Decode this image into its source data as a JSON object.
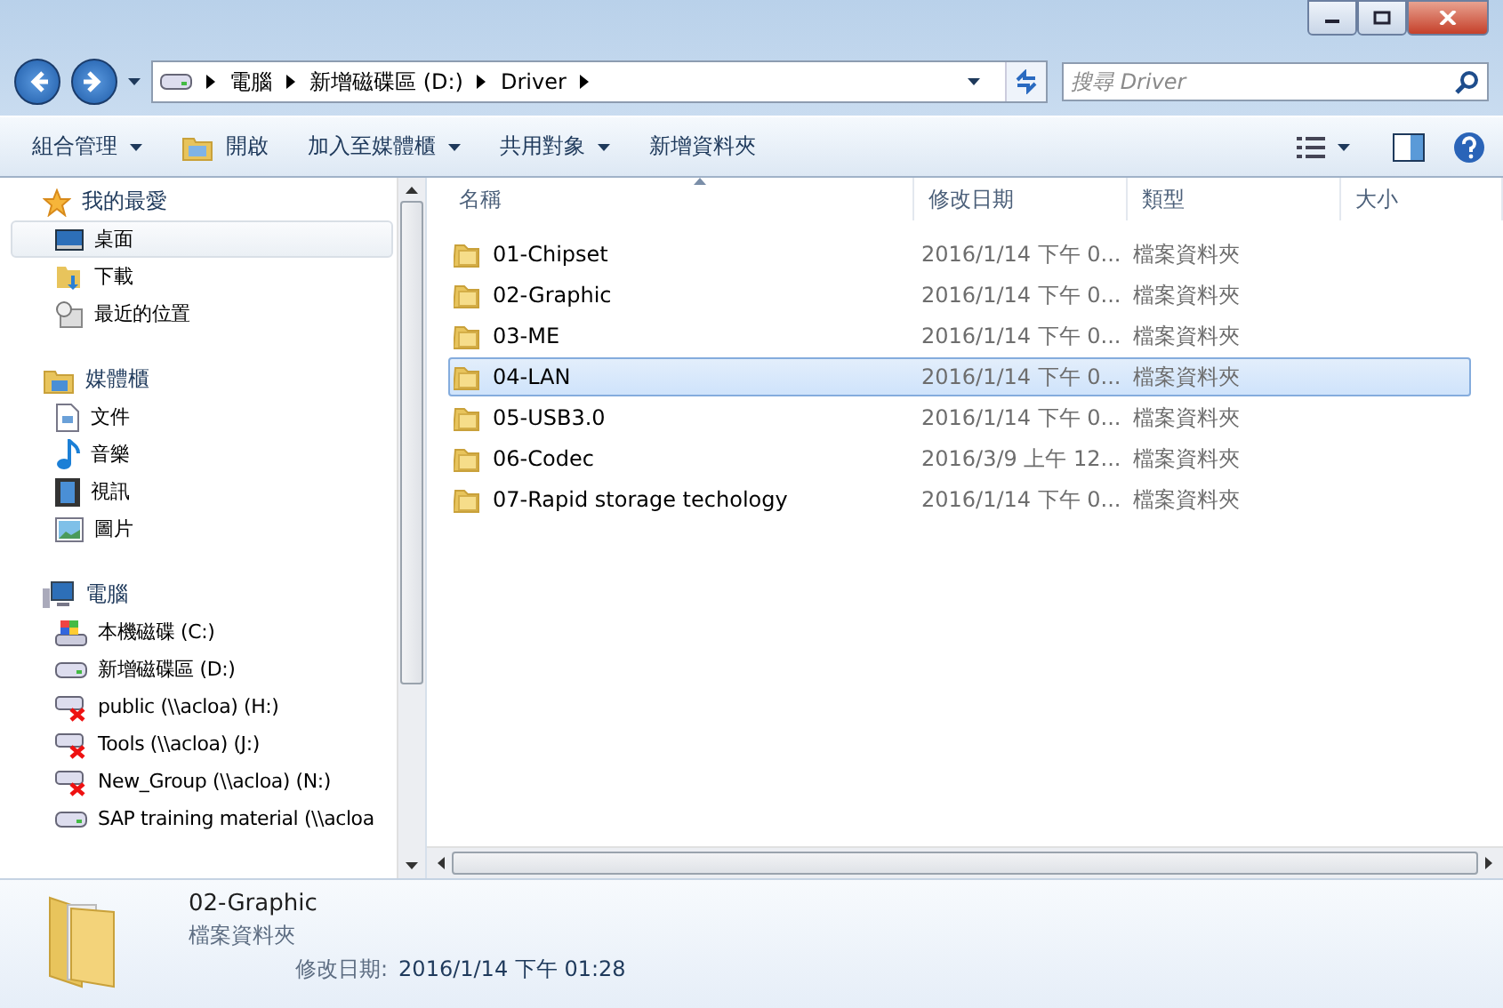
{
  "address": {
    "crumbs": [
      "電腦",
      "新增磁碟區 (D:)",
      "Driver"
    ],
    "search_placeholder": "搜尋 Driver"
  },
  "toolbar": {
    "items": [
      {
        "label": "組合管理",
        "menu": true,
        "kind": "text"
      },
      {
        "label": "開啟",
        "menu": false,
        "kind": "open"
      },
      {
        "label": "加入至媒體櫃",
        "menu": true,
        "kind": "text"
      },
      {
        "label": "共用對象",
        "menu": true,
        "kind": "text"
      },
      {
        "label": "新增資料夾",
        "menu": false,
        "kind": "text"
      }
    ]
  },
  "nav": {
    "groups": [
      {
        "label": "我的最愛",
        "kind": "star",
        "children": [
          {
            "label": "桌面",
            "kind": "desktop",
            "selected": true
          },
          {
            "label": "下載",
            "kind": "download",
            "selected": false
          },
          {
            "label": "最近的位置",
            "kind": "recent",
            "selected": false
          }
        ]
      },
      {
        "label": "媒體櫃",
        "kind": "library",
        "children": [
          {
            "label": "文件",
            "kind": "document",
            "selected": false
          },
          {
            "label": "音樂",
            "kind": "music",
            "selected": false
          },
          {
            "label": "視訊",
            "kind": "video",
            "selected": false
          },
          {
            "label": "圖片",
            "kind": "picture",
            "selected": false
          }
        ]
      },
      {
        "label": "電腦",
        "kind": "computer",
        "children": [
          {
            "label": "本機磁碟 (C:)",
            "kind": "sysdrive",
            "selected": false
          },
          {
            "label": "新增磁碟區 (D:)",
            "kind": "drive",
            "selected": false
          },
          {
            "label": "public (\\\\acloa) (H:)",
            "kind": "netdrive",
            "selected": false
          },
          {
            "label": "Tools (\\\\acloa) (J:)",
            "kind": "netdrive",
            "selected": false
          },
          {
            "label": "New_Group (\\\\acloa) (N:)",
            "kind": "netdrive",
            "selected": false
          },
          {
            "label": "SAP training material (\\\\acloa",
            "kind": "drive",
            "selected": false
          }
        ]
      }
    ]
  },
  "files": {
    "columns": [
      "名稱",
      "修改日期",
      "類型",
      "大小"
    ],
    "rows": [
      {
        "name": "01-Chipset",
        "date": "2016/1/14 下午 0...",
        "type": "檔案資料夾",
        "selected": false
      },
      {
        "name": "02-Graphic",
        "date": "2016/1/14 下午 0...",
        "type": "檔案資料夾",
        "selected": false
      },
      {
        "name": "03-ME",
        "date": "2016/1/14 下午 0...",
        "type": "檔案資料夾",
        "selected": false
      },
      {
        "name": "04-LAN",
        "date": "2016/1/14 下午 0...",
        "type": "檔案資料夾",
        "selected": true
      },
      {
        "name": "05-USB3.0",
        "date": "2016/1/14 下午 0...",
        "type": "檔案資料夾",
        "selected": false
      },
      {
        "name": "06-Codec",
        "date": "2016/3/9 上午 12...",
        "type": "檔案資料夾",
        "selected": false
      },
      {
        "name": "07-Rapid storage techology",
        "date": "2016/1/14 下午 0...",
        "type": "檔案資料夾",
        "selected": false
      }
    ]
  },
  "details": {
    "name": "02-Graphic",
    "type": "檔案資料夾",
    "date_label": "修改日期:",
    "date": "2016/1/14 下午 01:28"
  }
}
